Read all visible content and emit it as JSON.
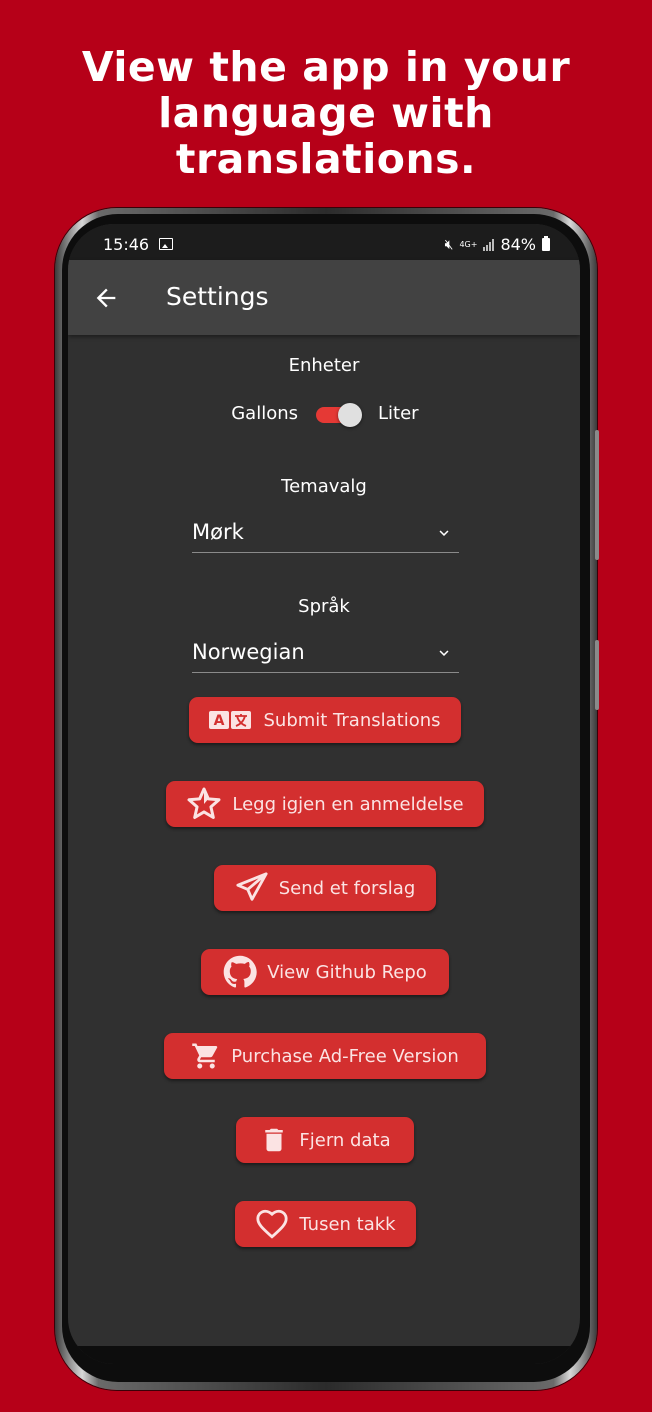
{
  "promo": {
    "line1": "View the app in your",
    "line2": "language with",
    "line3": "translations."
  },
  "statusbar": {
    "time": "15:46",
    "network": "4G+",
    "battery": "84%"
  },
  "appbar": {
    "title": "Settings"
  },
  "units": {
    "label": "Enheter",
    "left": "Gallons",
    "right": "Liter",
    "toggle_on": true
  },
  "theme": {
    "label": "Temavalg",
    "value": "Mørk"
  },
  "language": {
    "label": "Språk",
    "value": "Norwegian"
  },
  "buttons": {
    "submit_translations": "Submit Translations",
    "leave_review": "Legg igjen en anmeldelse",
    "send_suggestion": "Send et forslag",
    "github": "View Github Repo",
    "purchase": "Purchase Ad-Free Version",
    "delete_data": "Fjern data",
    "thanks": "Tusen takk"
  },
  "colors": {
    "background": "#b60018",
    "button": "#d32f2f",
    "screen": "#303030",
    "appbar": "#424242"
  }
}
